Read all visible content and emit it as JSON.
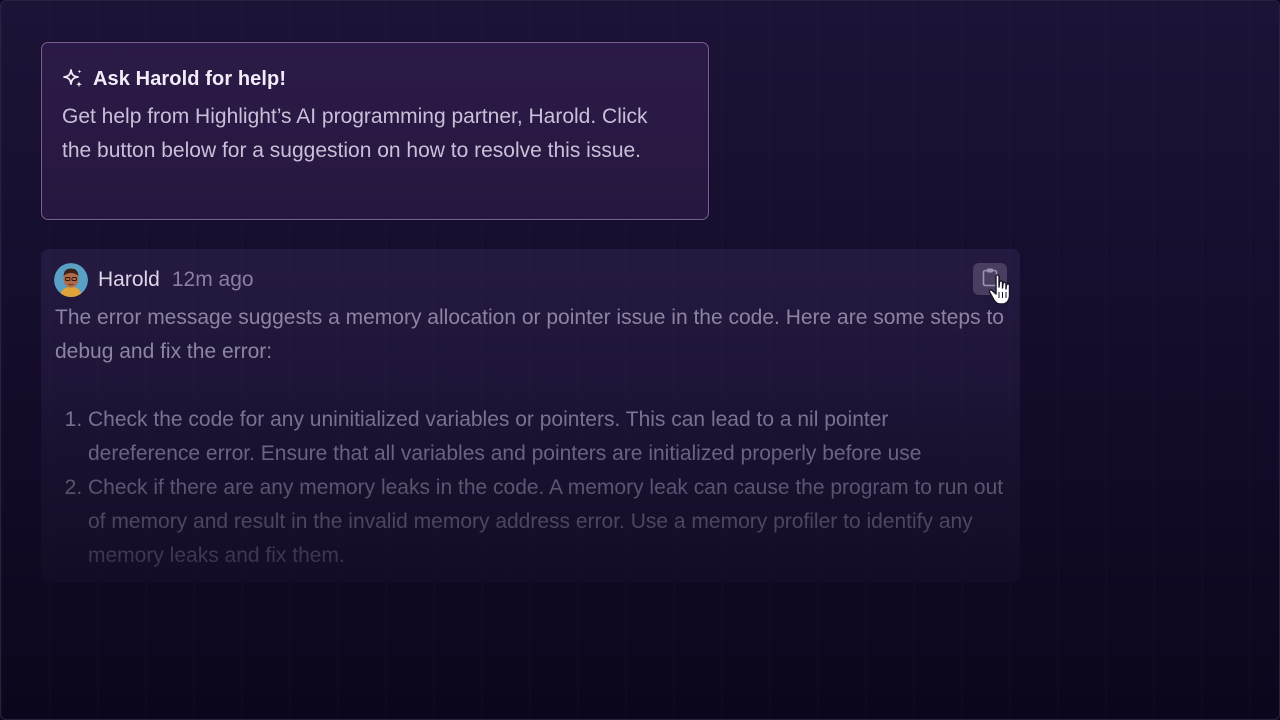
{
  "help_card": {
    "title": "Ask Harold for help!",
    "body": "Get help from Highlight’s AI programming partner, Harold. Click the button below for a suggestion on how to resolve this issue.",
    "icon": "sparkle-icon"
  },
  "answer": {
    "author": "Harold",
    "time": "12m ago",
    "intro": "The error message suggests a memory allocation or pointer issue in the code. Here are some steps to debug and fix the error:",
    "steps": [
      "Check the code for any uninitialized variables or pointers. This can lead to a nil pointer dereference error. Ensure that all variables and pointers are initialized properly before use",
      "Check if there are any memory leaks in the code. A memory leak can cause the program to run out of memory and result in the invalid memory address error. Use a memory profiler to identify any memory leaks and fix them."
    ],
    "copy_icon": "clipboard-icon",
    "cursor_icon": "hand-pointer-icon"
  },
  "colors": {
    "background": "#150d2c",
    "card_border": "#7a5e96",
    "card_bg": "#2b1a47",
    "answer_text": "#8d84a2"
  }
}
